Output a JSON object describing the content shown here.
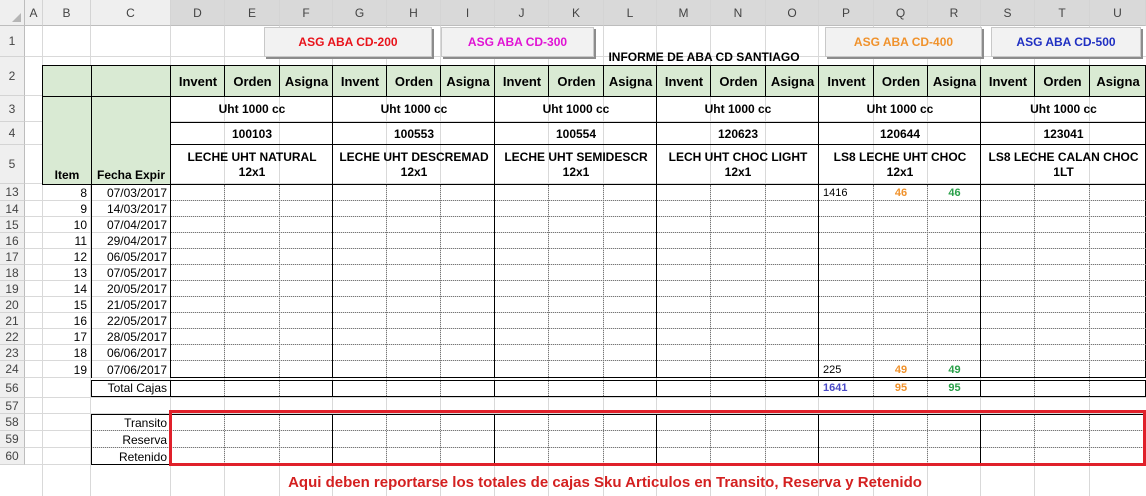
{
  "columns": [
    "A",
    "B",
    "C",
    "D",
    "E",
    "F",
    "G",
    "H",
    "I",
    "J",
    "K",
    "L",
    "M",
    "N",
    "O",
    "P",
    "Q",
    "R",
    "S",
    "T",
    "U"
  ],
  "rows": [
    "1",
    "2",
    "3",
    "4",
    "5",
    "13",
    "14",
    "15",
    "16",
    "17",
    "18",
    "19",
    "20",
    "21",
    "22",
    "23",
    "24",
    "56",
    "57",
    "58",
    "59",
    "60"
  ],
  "buttons": {
    "cd200": {
      "label": "ASG ABA CD-200",
      "color": "#e8131b"
    },
    "cd300": {
      "label": "ASG ABA CD-300",
      "color": "#e013d4"
    },
    "cd400": {
      "label": "ASG ABA CD-400",
      "color": "#f0922c"
    },
    "cd500": {
      "label": "ASG ABA CD-500",
      "color": "#1f2fc2"
    }
  },
  "report_title": "INFORME DE ABA CD SANTIAGO",
  "subheaders": [
    "Invent",
    "Orden",
    "Asigna"
  ],
  "headers": {
    "item": "Item",
    "fecha": "Fecha Expir"
  },
  "products": [
    {
      "pack": "Uht 1000 cc",
      "code": "100103",
      "name": "LECHE UHT NATURAL 12x1"
    },
    {
      "pack": "Uht 1000 cc",
      "code": "100553",
      "name": "LECHE UHT DESCREMAD 12x1"
    },
    {
      "pack": "Uht 1000 cc",
      "code": "100554",
      "name": "LECHE UHT SEMIDESCR 12x1"
    },
    {
      "pack": "Uht 1000 cc",
      "code": "120623",
      "name": "LECH UHT CHOC LIGHT 12x1"
    },
    {
      "pack": "Uht 1000 cc",
      "code": "120644",
      "name": "LS8 LECHE UHT CHOC 12x1"
    },
    {
      "pack": "Uht 1000 cc",
      "code": "123041",
      "name": "LS8 LECHE CALAN CHOC 1LT"
    }
  ],
  "data_rows": [
    {
      "item": "8",
      "fecha": "07/03/2017"
    },
    {
      "item": "9",
      "fecha": "14/03/2017"
    },
    {
      "item": "10",
      "fecha": "07/04/2017"
    },
    {
      "item": "11",
      "fecha": "29/04/2017"
    },
    {
      "item": "12",
      "fecha": "06/05/2017"
    },
    {
      "item": "13",
      "fecha": "07/05/2017"
    },
    {
      "item": "14",
      "fecha": "20/05/2017"
    },
    {
      "item": "15",
      "fecha": "21/05/2017"
    },
    {
      "item": "16",
      "fecha": "22/05/2017"
    },
    {
      "item": "17",
      "fecha": "28/05/2017"
    },
    {
      "item": "18",
      "fecha": "06/06/2017"
    },
    {
      "item": "19",
      "fecha": "07/06/2017"
    }
  ],
  "values": {
    "r13": {
      "invent": "1416",
      "orden": "46",
      "asigna": "46"
    },
    "r24": {
      "invent": "225",
      "orden": "49",
      "asigna": "49"
    },
    "total": {
      "invent": "1641",
      "orden": "95",
      "asigna": "95"
    }
  },
  "value_colors": {
    "invent_total": "#4a4ac8",
    "orden": "#f0922c",
    "asigna": "#2aa04a"
  },
  "total_label": "Total Cajas",
  "bottom_labels": [
    "Transito",
    "Reserva",
    "Retenido"
  ],
  "note": "Aqui deben reportarse los totales de cajas Sku Articulos en Transito, Reserva y Retenido",
  "note_color": "#d42020"
}
